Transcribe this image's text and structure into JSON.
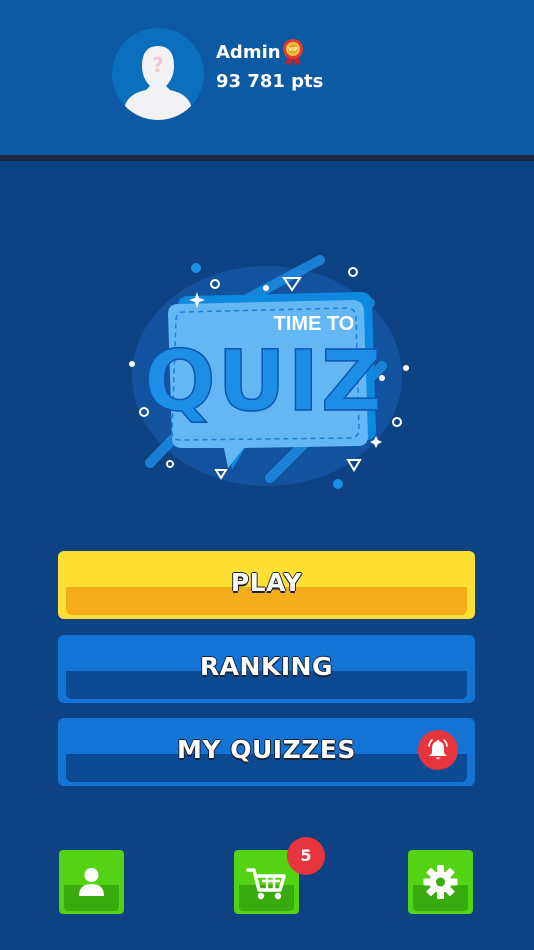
{
  "user": {
    "name": "Admin",
    "points": "93 781 pts",
    "badge_icon": "vip-medal-icon",
    "avatar_icon": "avatar-placeholder-icon"
  },
  "logo": {
    "line1": "TIME TO",
    "line2": "QUIZ"
  },
  "menu": {
    "play_label": "PLAY",
    "ranking_label": "RANKING",
    "my_quizzes_label": "MY QUIZZES",
    "notification_icon": "bell-icon"
  },
  "bottom_nav": {
    "profile_icon": "user-icon",
    "shop_icon": "cart-icon",
    "shop_badge": "5",
    "settings_icon": "gear-icon"
  },
  "colors": {
    "background": "#0e4383",
    "header": "#0c5aa3",
    "play": "#fde033",
    "play_shade": "#f5ac19",
    "menu_blue": "#1474d6",
    "nav_green": "#54d214",
    "badge_red": "#e8343c"
  }
}
